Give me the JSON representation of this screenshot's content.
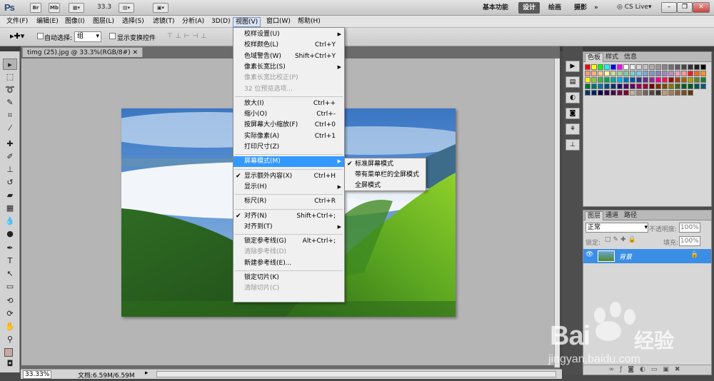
{
  "appbar": {
    "logo": "Ps",
    "br": "Br",
    "mb": "Mb",
    "zoom": "33.3",
    "workspaces": [
      "基本功能",
      "设计",
      "绘画",
      "摄影"
    ],
    "more": "»",
    "cslive": "CS Live"
  },
  "menubar": [
    "文件(F)",
    "编辑(E)",
    "图像(I)",
    "图层(L)",
    "选择(S)",
    "滤镜(T)",
    "分析(A)",
    "3D(D)",
    "视图(V)",
    "窗口(W)",
    "帮助(H)"
  ],
  "options": {
    "auto_select": "自动选择:",
    "auto_value": "组",
    "show_transform": "显示变换控件"
  },
  "document": {
    "tab": "timg (25).jpg @ 33.3%(RGB/8#)"
  },
  "status": {
    "zoom": "33.33%",
    "doc": "文档:6.59M/6.59M"
  },
  "view_menu": {
    "items": [
      {
        "label": "校样设置(U)",
        "key": "",
        "arrow": true,
        "dis": false,
        "ck": false
      },
      {
        "label": "校样颜色(L)",
        "key": "Ctrl+Y",
        "dis": false,
        "ck": false
      },
      {
        "label": "色域警告(W)",
        "key": "Shift+Ctrl+Y",
        "dis": false,
        "ck": false
      },
      {
        "label": "像素长宽比(S)",
        "key": "",
        "arrow": true,
        "dis": false,
        "ck": false
      },
      {
        "label": "像素长宽比校正(P)",
        "key": "",
        "dis": true,
        "ck": false
      },
      {
        "label": "32 位预览选项...",
        "key": "",
        "dis": true,
        "ck": false
      },
      {
        "label": "放大(I)",
        "key": "Ctrl++",
        "dis": false,
        "ck": false
      },
      {
        "label": "缩小(O)",
        "key": "Ctrl+-",
        "dis": false,
        "ck": false
      },
      {
        "label": "按屏幕大小缩放(F)",
        "key": "Ctrl+0",
        "dis": false,
        "ck": false
      },
      {
        "label": "实际像素(A)",
        "key": "Ctrl+1",
        "dis": false,
        "ck": false
      },
      {
        "label": "打印尺寸(Z)",
        "key": "",
        "dis": false,
        "ck": false
      },
      {
        "label": "屏幕模式(M)",
        "key": "",
        "arrow": true,
        "dis": false,
        "ck": false,
        "hl": true
      },
      {
        "label": "显示额外内容(X)",
        "key": "Ctrl+H",
        "dis": false,
        "ck": true
      },
      {
        "label": "显示(H)",
        "key": "",
        "arrow": true,
        "dis": false,
        "ck": false
      },
      {
        "label": "标尺(R)",
        "key": "Ctrl+R",
        "dis": false,
        "ck": false
      },
      {
        "label": "对齐(N)",
        "key": "Shift+Ctrl+;",
        "dis": false,
        "ck": true
      },
      {
        "label": "对齐到(T)",
        "key": "",
        "arrow": true,
        "dis": false,
        "ck": false
      },
      {
        "label": "锁定参考线(G)",
        "key": "Alt+Ctrl+;",
        "dis": false,
        "ck": false
      },
      {
        "label": "清除参考线(D)",
        "key": "",
        "dis": true,
        "ck": false
      },
      {
        "label": "新建参考线(E)...",
        "key": "",
        "dis": false,
        "ck": false
      },
      {
        "label": "锁定切片(K)",
        "key": "",
        "dis": false,
        "ck": false
      },
      {
        "label": "清除切片(C)",
        "key": "",
        "dis": true,
        "ck": false
      }
    ]
  },
  "screen_submenu": [
    {
      "label": "标准屏幕模式",
      "ck": true
    },
    {
      "label": "带有菜单栏的全屏模式",
      "ck": false
    },
    {
      "label": "全屏模式",
      "ck": false
    }
  ],
  "swatches_panel": {
    "tabs": [
      "色板",
      "样式",
      "信息"
    ]
  },
  "layers_panel": {
    "tabs": [
      "图层",
      "通道",
      "路径"
    ],
    "blend": "正常",
    "opacity_label": "不透明度:",
    "opacity": "100%",
    "lock_label": "锁定:",
    "fill_label": "填充:",
    "fill": "100%",
    "layer_name": "背景"
  },
  "watermark": {
    "logo": "Bai",
    "logo2": "经验",
    "url": "jingyan.baidu.com"
  }
}
